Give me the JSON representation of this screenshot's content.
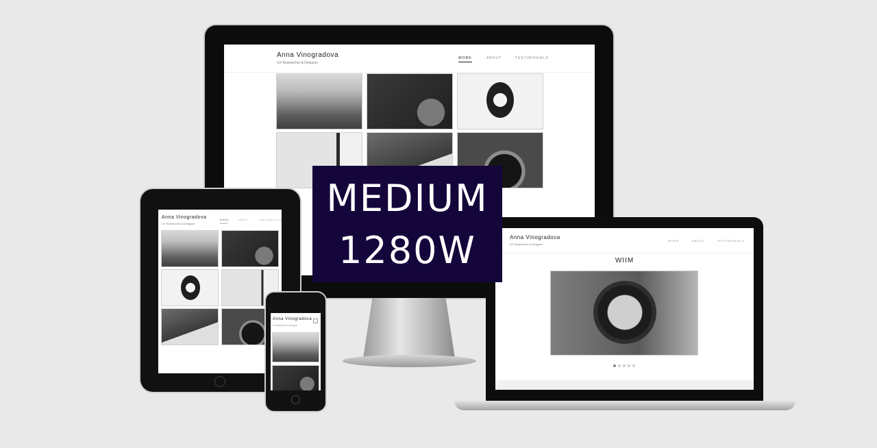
{
  "site": {
    "name": "Anna Vinogradova",
    "subtitle": "UX Researcher & Designer",
    "nav": [
      "WORK",
      "ABOUT",
      "TESTIMONIALS"
    ]
  },
  "tablet": {
    "work_sublabel": "Selected"
  },
  "laptop": {
    "project_title": "WIIM",
    "carousel": {
      "count": 5,
      "active_index": 0
    }
  },
  "badge": {
    "line1": "MEDIUM",
    "line2": "1280W",
    "background": "#14053a",
    "text_color": "#ffffff"
  }
}
